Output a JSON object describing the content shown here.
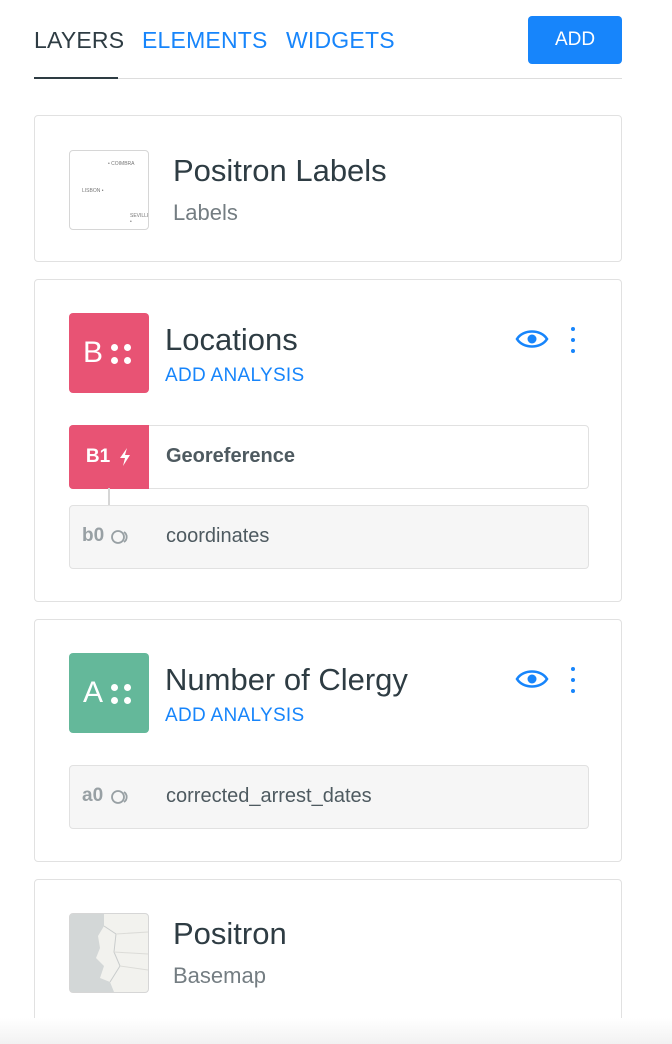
{
  "tabs": {
    "layers": "LAYERS",
    "elements": "ELEMENTS",
    "widgets": "WIDGETS",
    "add_button": "ADD"
  },
  "layers": [
    {
      "title": "Positron Labels",
      "subtitle": "Labels",
      "thumb_labels": [
        "• COIMBRA",
        "LISBON •",
        "SEVILLE •"
      ]
    },
    {
      "letter": "B",
      "title": "Locations",
      "add_analysis": "ADD ANALYSIS",
      "color": "#e85374",
      "analysis_node": {
        "id": "B1",
        "label": "Georeference"
      },
      "source_node": {
        "id": "b0",
        "label": "coordinates"
      }
    },
    {
      "letter": "A",
      "title": "Number of Clergy",
      "add_analysis": "ADD ANALYSIS",
      "color": "#64b89a",
      "source_node": {
        "id": "a0",
        "label": "corrected_arrest_dates"
      }
    },
    {
      "title": "Positron",
      "subtitle": "Basemap"
    }
  ],
  "colors": {
    "accent": "#1785fb",
    "text": "#2e3c43",
    "muted": "#747d82"
  },
  "icons": {
    "visibility": "eye-icon",
    "options": "kebab-menu-icon",
    "analysis": "lightning-icon",
    "source": "source-ring-icon"
  }
}
